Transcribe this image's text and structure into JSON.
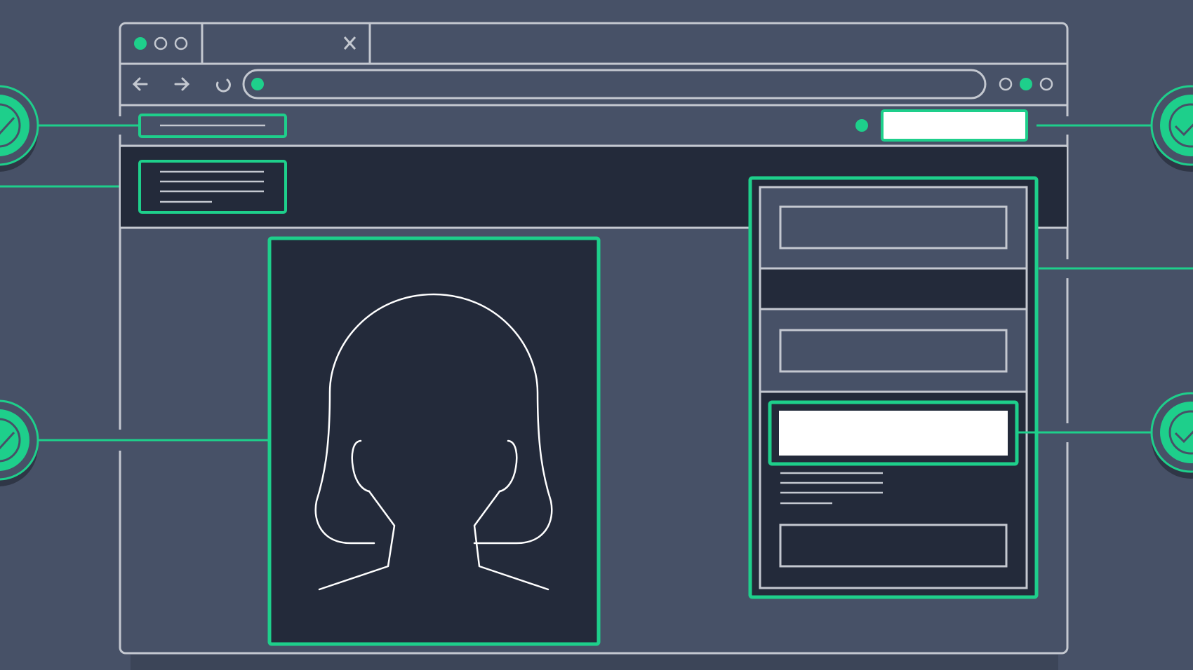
{
  "colors": {
    "background": "#475167",
    "panel_dark": "#232a3a",
    "outline": "#c4c8d0",
    "accent": "#1ecf8b",
    "white": "#ffffff"
  },
  "browser": {
    "window_controls": [
      "green-dot",
      "outline-dot",
      "outline-dot"
    ],
    "tab_close_icon": "close-icon",
    "nav_icons": [
      "back-arrow-icon",
      "forward-arrow-icon",
      "reload-icon"
    ],
    "address_bar_status_icon": "green-dot",
    "toolbar_dots": [
      "outline-dot",
      "green-dot",
      "outline-dot"
    ]
  },
  "callouts": {
    "left": [
      "check-badge-icon",
      "check-badge-icon"
    ],
    "right": [
      "check-badge-icon",
      "check-badge-icon"
    ]
  },
  "page": {
    "hero_image_icon": "person-silhouette-icon",
    "form_highlighted_field": "primary-input-white"
  }
}
